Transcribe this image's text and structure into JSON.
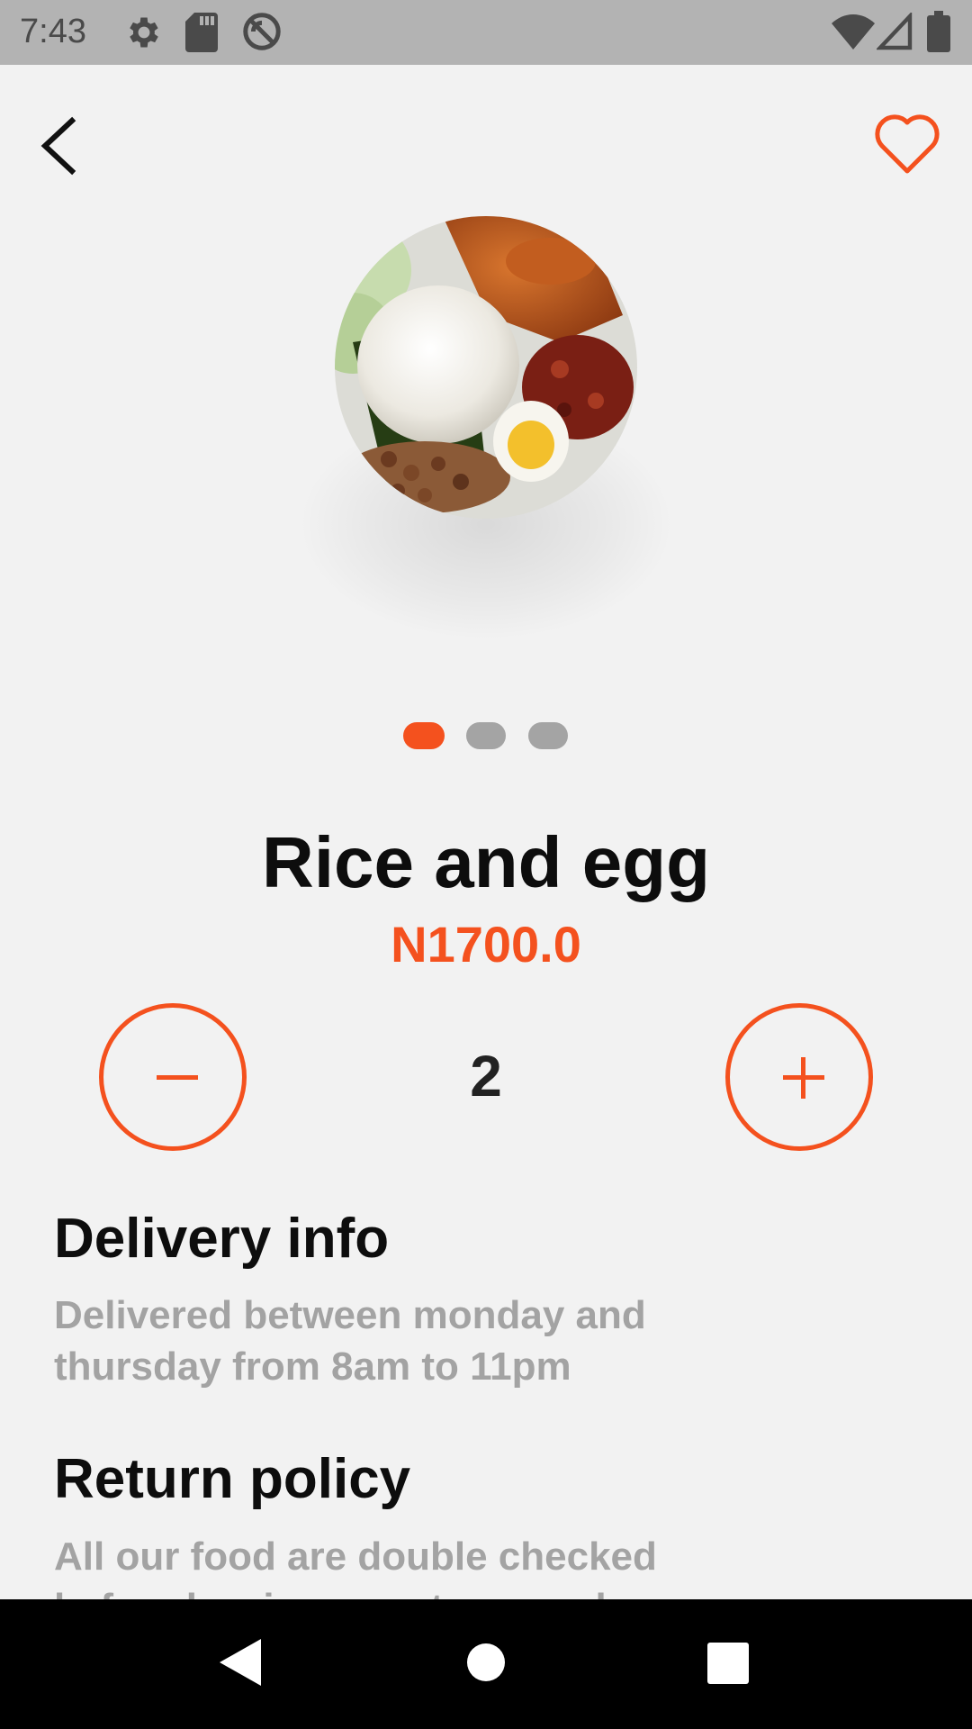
{
  "status_bar": {
    "time": "7:43",
    "icons": [
      "settings-icon",
      "sd-card-icon",
      "do-not-disturb-icon",
      "wifi-icon",
      "signal-icon",
      "battery-icon"
    ]
  },
  "header": {
    "back_icon": "chevron-left-icon",
    "favorite_icon": "heart-outline-icon"
  },
  "product": {
    "image_alt": "Plate of rice with egg, chicken, peanuts and sambal",
    "name": "Rice and egg",
    "price": "N1700.0",
    "carousel": {
      "count": 3,
      "active_index": 0
    }
  },
  "quantity": {
    "value": "2",
    "decrement_icon": "minus-icon",
    "increment_icon": "plus-icon"
  },
  "delivery": {
    "title": "Delivery info",
    "text": "Delivered between monday and thursday from 8am to 11pm"
  },
  "return_policy": {
    "title": "Return policy",
    "text": "All our food are double checked before leaving our stores so by"
  },
  "nav": {
    "back_icon": "nav-back-icon",
    "home_icon": "nav-home-icon",
    "recents_icon": "nav-recents-icon"
  },
  "colors": {
    "accent": "#f4511e",
    "background": "#f2f2f2",
    "status_bar": "#b3b3b3",
    "muted_text": "#a3a3a3",
    "dot_inactive": "#a4a4a4"
  }
}
